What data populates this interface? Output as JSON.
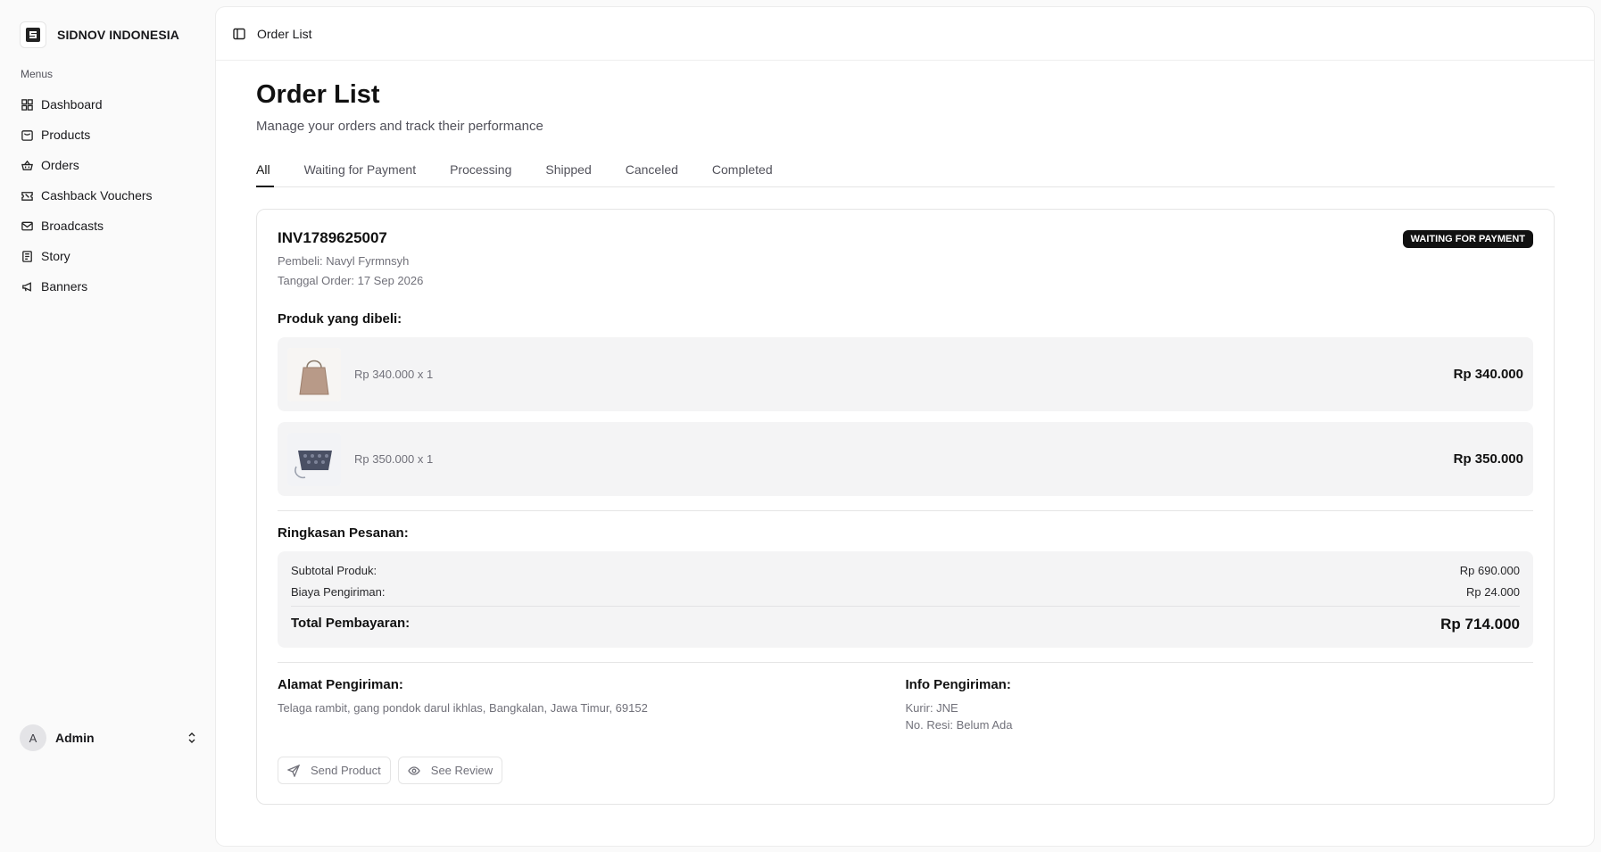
{
  "brand": {
    "name": "SIDNOV INDONESIA"
  },
  "sidebar": {
    "section_label": "Menus",
    "items": [
      {
        "label": "Dashboard",
        "icon": "grid-icon"
      },
      {
        "label": "Products",
        "icon": "box-icon"
      },
      {
        "label": "Orders",
        "icon": "basket-icon"
      },
      {
        "label": "Cashback Vouchers",
        "icon": "ticket-icon"
      },
      {
        "label": "Broadcasts",
        "icon": "mail-icon"
      },
      {
        "label": "Story",
        "icon": "story-icon"
      },
      {
        "label": "Banners",
        "icon": "megaphone-icon"
      }
    ],
    "user": {
      "initial": "A",
      "name": "Admin"
    }
  },
  "topbar": {
    "breadcrumb": "Order List"
  },
  "page": {
    "title": "Order List",
    "subtitle": "Manage your orders and track their performance"
  },
  "tabs": [
    "All",
    "Waiting for Payment",
    "Processing",
    "Shipped",
    "Canceled",
    "Completed"
  ],
  "order": {
    "invoice": "INV1789625007",
    "buyer": "Pembeli: Navyl Fyrmnsyh",
    "date": "Tanggal Order: 17 Sep 2026",
    "status": "WAITING FOR PAYMENT",
    "products_title": "Produk yang dibeli:",
    "items": [
      {
        "qty_text": "Rp 340.000 x 1",
        "total": "Rp 340.000"
      },
      {
        "qty_text": "Rp 350.000 x 1",
        "total": "Rp 350.000"
      }
    ],
    "summary_title": "Ringkasan Pesanan:",
    "summary": {
      "subtotal_label": "Subtotal Produk:",
      "subtotal_value": "Rp 690.000",
      "shipping_label": "Biaya Pengiriman:",
      "shipping_value": "Rp 24.000",
      "total_label": "Total Pembayaran:",
      "total_value": "Rp 714.000"
    },
    "address_title": "Alamat Pengiriman:",
    "address": "Telaga rambit, gang pondok darul ikhlas, Bangkalan, Jawa Timur, 69152",
    "shipping_title": "Info Pengiriman:",
    "courier": "Kurir: JNE",
    "tracking": "No. Resi: Belum Ada",
    "actions": {
      "send": "Send Product",
      "review": "See Review"
    }
  },
  "colors": {
    "accent": "#111111",
    "muted": "#71717a",
    "panel": "#f4f4f5"
  }
}
